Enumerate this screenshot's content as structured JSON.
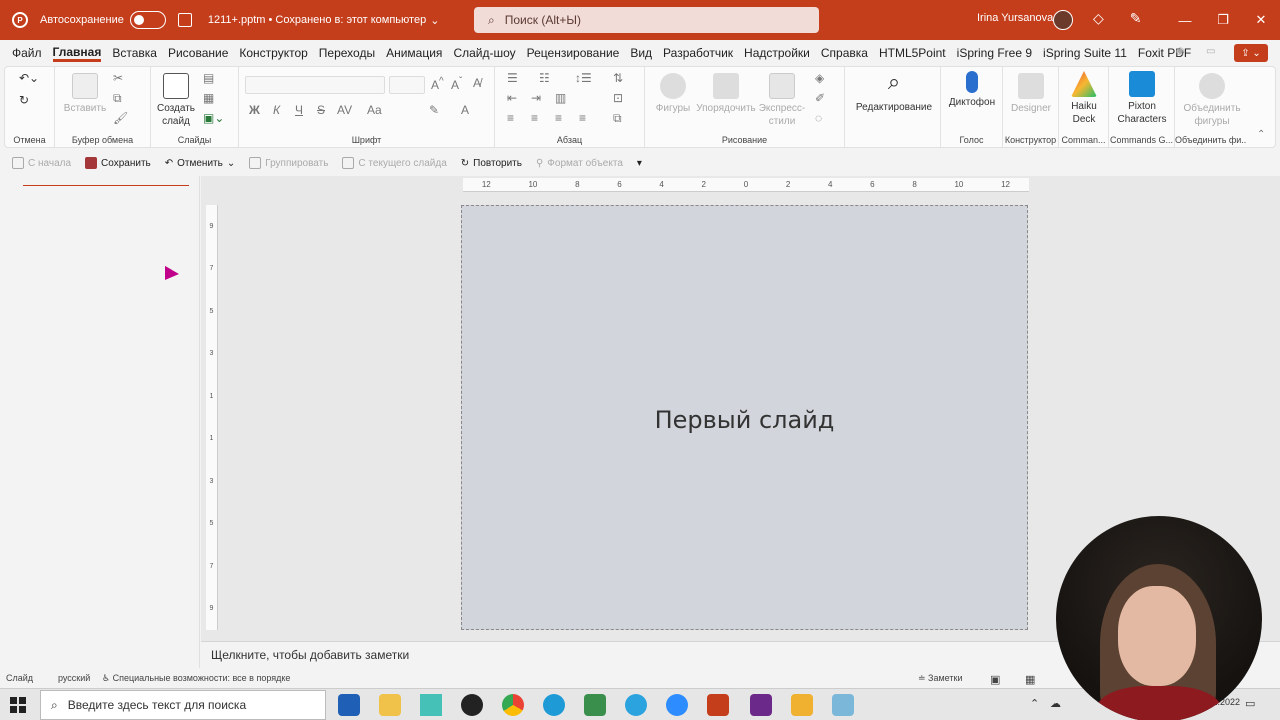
{
  "titlebar": {
    "autosave_label": "Автосохранение",
    "doc_name": "1211+.pptm • Сохранено в: этот компьютер",
    "search_placeholder": "Поиск (Alt+Ы)",
    "user_name": "Irina Yursanova"
  },
  "tabs": [
    "Файл",
    "Главная",
    "Вставка",
    "Рисование",
    "Конструктор",
    "Переходы",
    "Анимация",
    "Слайд-шоу",
    "Рецензирование",
    "Вид",
    "Разработчик",
    "Надстройки",
    "Справка",
    "HTML5Point",
    "iSpring Free 9",
    "iSpring Suite 11",
    "Foxit PDF"
  ],
  "active_tab": "Главная",
  "ribbon": {
    "groups": {
      "undo": "Отмена",
      "clipboard": "Буфер обмена",
      "slides": "Слайды",
      "font": "Шрифт",
      "paragraph": "Абзац",
      "drawing": "Рисование",
      "voice": "Голос",
      "designer": "Конструктор",
      "commands1": "Comman...",
      "commands2": "Commands G...",
      "merge": "Объединить фи..."
    },
    "buttons": {
      "paste": "Вставить",
      "new_slide": "Создать\nслайд",
      "shapes": "Фигуры",
      "arrange": "Упорядочить",
      "quick_styles": "Экспресс-\nстили",
      "editing": "Редактирование",
      "dictate": "Диктофон",
      "designer": "Designer",
      "haiku": "Haiku\nDeck",
      "pixton": "Pixton\nCharacters",
      "merge_shapes": "Объединить\nфигуры"
    },
    "font_letters": [
      "Ж",
      "К",
      "Ч",
      "S",
      "AV",
      "Aa"
    ]
  },
  "qat": {
    "from_start": "С начала",
    "save": "Сохранить",
    "undo": "Отменить",
    "group": "Группировать",
    "from_current": "С текущего слайда",
    "redo": "Повторить",
    "format": "Формат объекта"
  },
  "slide": {
    "title": "Первый слайд"
  },
  "notes_placeholder": "Щелкните, чтобы добавить заметки",
  "status": {
    "slide": "Слайд",
    "language": "русский",
    "accessibility": "Специальные возможности: все в порядке",
    "notes": "Заметки"
  },
  "taskbar": {
    "search_placeholder": "Введите здесь текст для поиска",
    "date_partial": "...1.2022"
  },
  "colors": {
    "accent": "#c43e1c",
    "slide_bg": "#d2d5db"
  }
}
